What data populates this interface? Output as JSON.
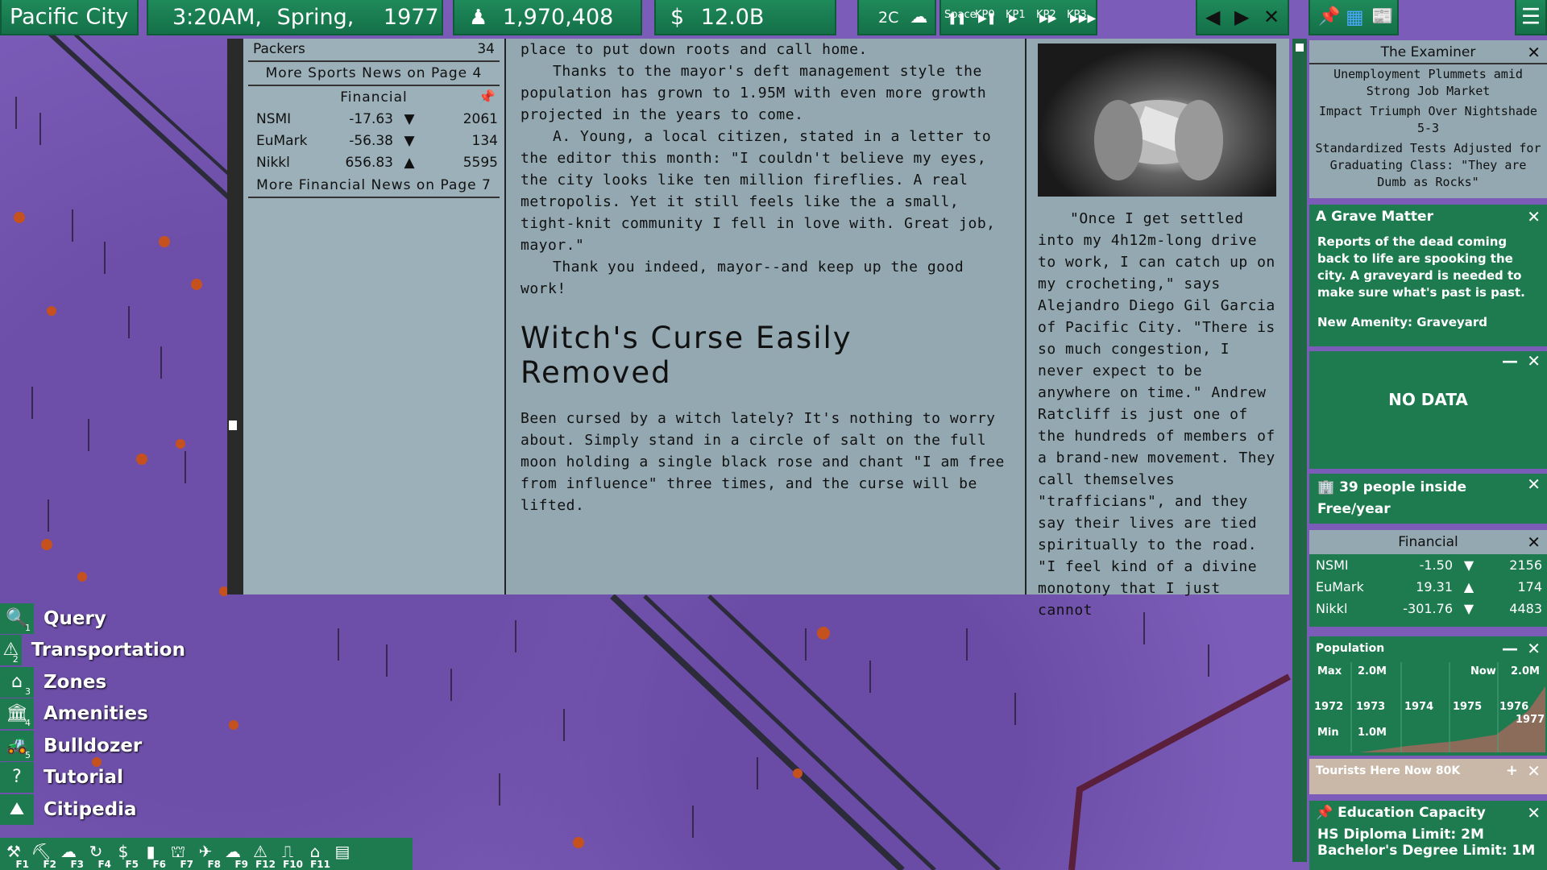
{
  "topbar": {
    "city": "Pacific City",
    "time": "3:20AM,",
    "season": "Spring,",
    "year": "1977",
    "population": "1,970,408",
    "money_symbol": "$",
    "money": "12.0B",
    "temperature": "2C",
    "speed_controls": [
      {
        "glyph": "❚❚",
        "label": "Space"
      },
      {
        "glyph": "▶❚",
        "label": "KP0"
      },
      {
        "glyph": "▶",
        "label": "KP1"
      },
      {
        "glyph": "▶▶",
        "label": "KP2"
      },
      {
        "glyph": "▶▶▶",
        "label": "KP3"
      }
    ],
    "nav": {
      "prev": "◀",
      "next": "▶",
      "close": "✕"
    }
  },
  "newspaper": {
    "sports_tail": {
      "team": "Packers",
      "score": "34"
    },
    "more_sports": "More Sports News on Page 4",
    "financial_title": "Financial",
    "financial_rows": [
      {
        "name": "NSMI",
        "change": "-17.63",
        "arrow": "▼",
        "value": "2061"
      },
      {
        "name": "EuMark",
        "change": "-56.38",
        "arrow": "▼",
        "value": "134"
      },
      {
        "name": "Nikkl",
        "change": "656.83",
        "arrow": "▲",
        "value": "5595"
      }
    ],
    "more_financial": "More Financial News on Page 7",
    "article_top": [
      "place to put down roots and call home.",
      "Thanks to the mayor's deft management style the population has grown to 1.95M with even more growth projected in the years to come.",
      "A. Young, a local citizen, stated in a letter to the editor this month: \"I couldn't believe my eyes, the city looks like ten million fireflies. A real metropolis. Yet it still feels like the a small, tight-knit community I fell in love with. Great job, mayor.\"",
      "Thank you indeed, mayor--and keep up the good work!"
    ],
    "headline2": "Witch's Curse Easily Removed",
    "article2": "Been cursed by a witch lately? It's nothing to worry about. Simply stand in a circle of salt on the full moon holding a single black rose and chant \"I am free from influence\" three times, and the curse will be lifted.",
    "right_article": "\"Once I get settled into my 4h12m-long drive to work, I can catch up on my crocheting,\" says Alejandro Diego Gil Garcia of Pacific City. \"There is so much congestion, I never expect to be anywhere on time.\" Andrew Ratcliff is just one of the hundreds of members of a brand-new movement. They call themselves \"trafficians\", and they say their lives are tied spiritually to the road. \"I feel kind of a divine monotony that I just cannot"
  },
  "panels": {
    "examiner": {
      "title": "The Examiner",
      "headlines": [
        "Unemployment Plummets amid Strong Job Market",
        "Impact Triumph Over Nightshade 5-3",
        "Standardized Tests Adjusted for Graduating Class: \"They are Dumb as Rocks\""
      ]
    },
    "grave": {
      "title": "A Grave Matter",
      "body": "Reports of the dead coming back to life are spooking the city. A graveyard is needed to make sure what's past is past.",
      "amenity": "New Amenity: Graveyard"
    },
    "nodata": {
      "text": "NO DATA"
    },
    "people": {
      "line1": "39 people inside",
      "line2": "Free/year"
    },
    "financial": {
      "title": "Financial",
      "rows": [
        {
          "name": "NSMI",
          "change": "-1.50",
          "arrow": "▼",
          "value": "2156"
        },
        {
          "name": "EuMark",
          "change": "19.31",
          "arrow": "▲",
          "value": "174"
        },
        {
          "name": "Nikkl",
          "change": "-301.76",
          "arrow": "▼",
          "value": "4483"
        }
      ]
    },
    "population": {
      "title": "Population",
      "max_label": "Max",
      "max_value": "2.0M",
      "now_label": "Now",
      "now_value": "2.0M",
      "min_label": "Min",
      "min_value": "1.0M",
      "years": [
        "1972",
        "1973",
        "1974",
        "1975",
        "1976",
        "1977"
      ]
    },
    "tourists": {
      "text": "Tourists Here Now 80K"
    },
    "education": {
      "title": "Education Capacity",
      "lines": [
        "HS Diploma Limit: 2M",
        "Bachelor's Degree Limit: 1M"
      ]
    }
  },
  "menu": [
    {
      "icon": "magnifier-icon",
      "glyph": "🔍",
      "key": "1",
      "label": "Query"
    },
    {
      "icon": "traffic-cone-icon",
      "glyph": "⚠",
      "key": "2",
      "label": "Transportation"
    },
    {
      "icon": "house-icon",
      "glyph": "⌂",
      "key": "3",
      "label": "Zones"
    },
    {
      "icon": "building-icon",
      "glyph": "🏛",
      "key": "4",
      "label": "Amenities"
    },
    {
      "icon": "bulldozer-icon",
      "glyph": "🚜",
      "key": "5",
      "label": "Bulldozer"
    },
    {
      "icon": "help-icon",
      "glyph": "?",
      "key": "",
      "label": "Tutorial"
    },
    {
      "icon": "citipedia-icon",
      "glyph": "⛰",
      "key": "",
      "label": "Citipedia"
    }
  ],
  "fkeys": [
    "F1",
    "F2",
    "F3",
    "F4",
    "F5",
    "F6",
    "F7",
    "F8",
    "F9",
    "F12",
    "F10",
    "F11",
    ""
  ]
}
